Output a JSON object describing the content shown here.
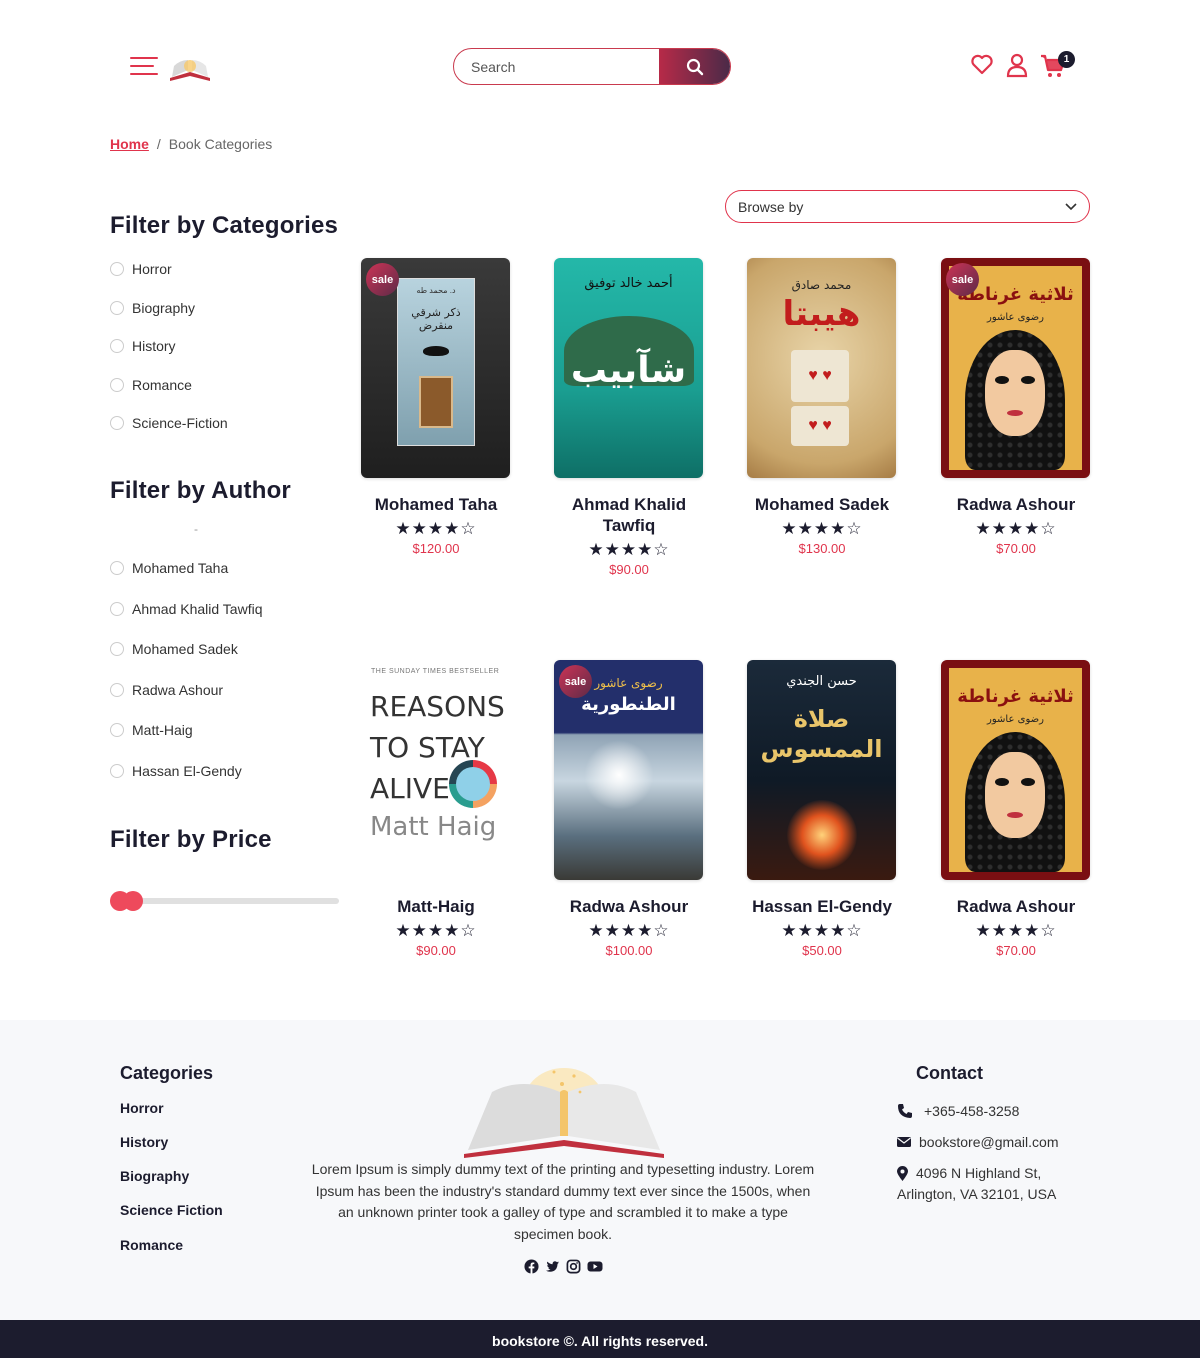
{
  "header": {
    "search_placeholder": "Search",
    "cart_count": "1"
  },
  "breadcrumb": {
    "home": "Home",
    "separator": "/",
    "current": "Book Categories"
  },
  "browse": {
    "label": "Browse by"
  },
  "sidebar": {
    "categories_title": "Filter by Categories",
    "categories": [
      "Horror",
      "Biography",
      "History",
      "Romance",
      "Science-Fiction"
    ],
    "author_title": "Filter by Author",
    "author_dash": "-",
    "authors": [
      "Mohamed Taha",
      "Ahmad Khalid Tawfiq",
      "Mohamed Sadek",
      "Radwa Ashour",
      "Matt-Haig",
      "Hassan El-Gendy"
    ],
    "price_title": "Filter by Price"
  },
  "sale_label": "sale",
  "books": [
    {
      "title": "Mohamed Taha",
      "price": "$120.00",
      "stars": "★★★★☆",
      "sale": true,
      "cover_title": "ذكر شرقي منقرض",
      "cover_author": "د. محمد طه"
    },
    {
      "title": "Ahmad Khalid Tawfiq",
      "price": "$90.00",
      "stars": "★★★★☆",
      "sale": false,
      "cover_title": "شآبيب",
      "cover_author": "أحمد خالد توفيق"
    },
    {
      "title": "Mohamed Sadek",
      "price": "$130.00",
      "stars": "★★★★☆",
      "sale": false,
      "cover_title": "هيبتا",
      "cover_author": "محمد صادق"
    },
    {
      "title": "Radwa Ashour",
      "price": "$70.00",
      "stars": "★★★★☆",
      "sale": true,
      "cover_title": "ثلاثية غرناطة",
      "cover_author": "رضوى عاشور"
    },
    {
      "title": "Matt-Haig",
      "price": "$90.00",
      "stars": "★★★★☆",
      "sale": false,
      "cover_title": "REASONS TO STAY ALIVE",
      "cover_author": "Matt Haig",
      "cover_top": "THE SUNDAY TIMES BESTSELLER"
    },
    {
      "title": "Radwa Ashour",
      "price": "$100.00",
      "stars": "★★★★☆",
      "sale": true,
      "cover_title": "الطنطورية",
      "cover_author": "رضوى عاشور"
    },
    {
      "title": "Hassan El-Gendy",
      "price": "$50.00",
      "stars": "★★★★☆",
      "sale": false,
      "cover_title": "صلاة الممسوس",
      "cover_author": "حسن الجندي"
    },
    {
      "title": "Radwa Ashour",
      "price": "$70.00",
      "stars": "★★★★☆",
      "sale": false,
      "cover_title": "ثلاثية غرناطة",
      "cover_author": "رضوى عاشور"
    }
  ],
  "footer": {
    "categories_title": "Categories",
    "categories": [
      "Horror",
      "History",
      "Biography",
      "Science Fiction",
      "Romance"
    ],
    "about": "Lorem Ipsum is simply dummy text of the printing and typesetting industry. Lorem Ipsum has been the industry's standard dummy text ever since the 1500s, when an unknown printer took a galley of type and scrambled it to make a type specimen book.",
    "contact_title": "Contact",
    "phone": "+365-458-3258",
    "email": "bookstore@gmail.com",
    "address_line1": "4096 N Highland St,",
    "address_line2": "Arlington, VA 32101, USA",
    "copyright": "bookstore ©. All rights reserved."
  },
  "colors": {
    "accent": "#e0344c",
    "dark": "#1c1c2e"
  }
}
